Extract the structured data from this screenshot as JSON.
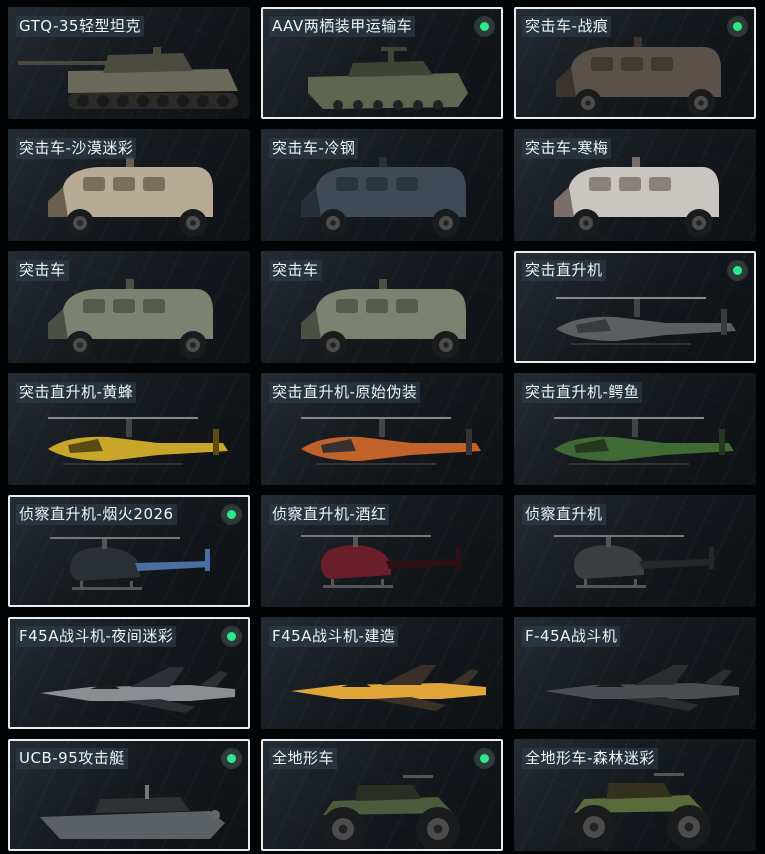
{
  "vehicles": [
    {
      "name": "GTQ-35轻型坦克",
      "selected": false,
      "owned": false,
      "kind": "tank",
      "color": "#6b6a5a",
      "accent": "#4a4a3e"
    },
    {
      "name": "AAV两栖装甲运输车",
      "selected": true,
      "owned": true,
      "kind": "aav",
      "color": "#5f6650",
      "accent": "#3f4535"
    },
    {
      "name": "突击车-战痕",
      "selected": true,
      "owned": true,
      "kind": "truck",
      "color": "#5a5248",
      "accent": "#3a342e"
    },
    {
      "name": "突击车-沙漠迷彩",
      "selected": false,
      "owned": false,
      "kind": "truck",
      "color": "#b8ab95",
      "accent": "#6a5e4e"
    },
    {
      "name": "突击车-冷钢",
      "selected": false,
      "owned": false,
      "kind": "truck",
      "color": "#3e4a57",
      "accent": "#25303b"
    },
    {
      "name": "突击车-寒梅",
      "selected": false,
      "owned": false,
      "kind": "truck",
      "color": "#c9c6c2",
      "accent": "#7a6e6a"
    },
    {
      "name": "突击车",
      "selected": false,
      "owned": false,
      "kind": "truck",
      "color": "#7c8170",
      "accent": "#4c5044"
    },
    {
      "name": "突击车",
      "selected": false,
      "owned": false,
      "kind": "truck",
      "color": "#7c8170",
      "accent": "#4c5044"
    },
    {
      "name": "突击直升机",
      "selected": true,
      "owned": true,
      "kind": "apache",
      "color": "#5b5f61",
      "accent": "#393c3e"
    },
    {
      "name": "突击直升机-黄蜂",
      "selected": false,
      "owned": false,
      "kind": "apache",
      "color": "#c9a52a",
      "accent": "#5a4a14"
    },
    {
      "name": "突击直升机-原始伪装",
      "selected": false,
      "owned": false,
      "kind": "apache",
      "color": "#c0622a",
      "accent": "#3a3030"
    },
    {
      "name": "突击直升机-鳄鱼",
      "selected": false,
      "owned": false,
      "kind": "apache",
      "color": "#3f6a34",
      "accent": "#24381f"
    },
    {
      "name": "侦察直升机-烟火2026",
      "selected": true,
      "owned": true,
      "kind": "scout",
      "color": "#2a3036",
      "accent": "#4a6fa0"
    },
    {
      "name": "侦察直升机-酒红",
      "selected": false,
      "owned": false,
      "kind": "scout",
      "color": "#6a1e2a",
      "accent": "#2e1014"
    },
    {
      "name": "侦察直升机",
      "selected": false,
      "owned": false,
      "kind": "scout",
      "color": "#3a3e40",
      "accent": "#25282a"
    },
    {
      "name": "F45A战斗机-夜间迷彩",
      "selected": true,
      "owned": true,
      "kind": "jet",
      "color": "#8a8e92",
      "accent": "#2c3034"
    },
    {
      "name": "F45A战斗机-建造",
      "selected": false,
      "owned": false,
      "kind": "jet",
      "color": "#e0a63a",
      "accent": "#3a3028"
    },
    {
      "name": "F-45A战斗机",
      "selected": false,
      "owned": false,
      "kind": "jet",
      "color": "#4a4e52",
      "accent": "#2a2d30"
    },
    {
      "name": "UCB-95攻击艇",
      "selected": true,
      "owned": true,
      "kind": "boat",
      "color": "#5a6064",
      "accent": "#2e3234"
    },
    {
      "name": "全地形车",
      "selected": true,
      "owned": true,
      "kind": "atv",
      "color": "#4e5a3e",
      "accent": "#2a2f24"
    },
    {
      "name": "全地形车-森林迷彩",
      "selected": false,
      "owned": false,
      "kind": "atv",
      "color": "#5a6a3a",
      "accent": "#33301e"
    }
  ]
}
